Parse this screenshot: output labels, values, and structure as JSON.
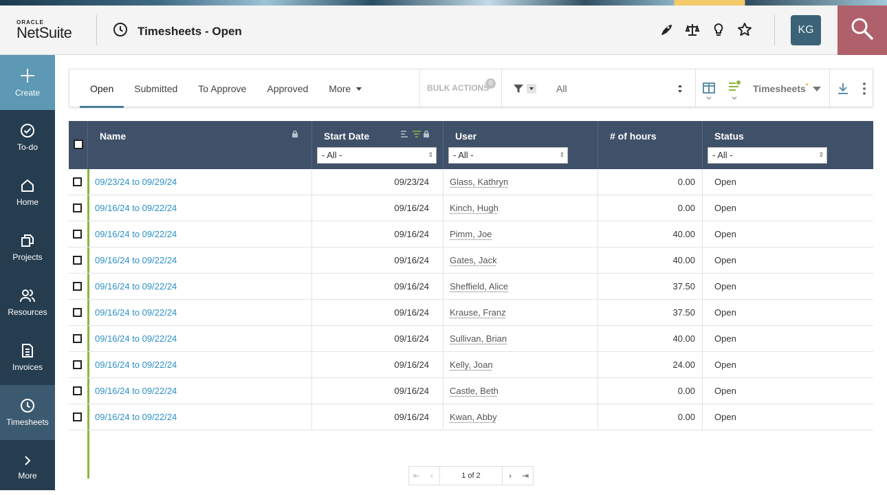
{
  "app": {
    "logo_small": "ORACLE",
    "logo_big": "NetSuite",
    "page_title": "Timesheets - Open",
    "user_initials": "KG"
  },
  "sidebar": {
    "items": [
      {
        "label": "Create",
        "icon": "plus-icon"
      },
      {
        "label": "To-do",
        "icon": "check-circle-icon"
      },
      {
        "label": "Home",
        "icon": "home-icon"
      },
      {
        "label": "Projects",
        "icon": "projects-icon"
      },
      {
        "label": "Resources",
        "icon": "people-icon"
      },
      {
        "label": "Invoices",
        "icon": "invoice-icon"
      },
      {
        "label": "Timesheets",
        "icon": "clock-icon"
      },
      {
        "label": "More",
        "icon": "chevron-right-icon"
      }
    ]
  },
  "toolbar": {
    "tabs": [
      "Open",
      "Submitted",
      "To Approve",
      "Approved",
      "More"
    ],
    "bulk_actions": "BULK ACTIONS",
    "bulk_count": "0",
    "filter_value": "All",
    "saved_search": "Timesheets",
    "saved_search_mark": "*"
  },
  "table": {
    "columns": {
      "name": "Name",
      "start_date": "Start Date",
      "user": "User",
      "hours": "# of hours",
      "status": "Status"
    },
    "filters": {
      "name": "- All -",
      "user": "- All -",
      "status": "- All -"
    },
    "rows": [
      {
        "name": "09/23/24 to 09/29/24",
        "start": "09/23/24",
        "user": "Glass, Kathryn",
        "hours": "0.00",
        "status": "Open"
      },
      {
        "name": "09/16/24 to 09/22/24",
        "start": "09/16/24",
        "user": "Kinch, Hugh",
        "hours": "0.00",
        "status": "Open"
      },
      {
        "name": "09/16/24 to 09/22/24",
        "start": "09/16/24",
        "user": "Pimm, Joe",
        "hours": "40.00",
        "status": "Open"
      },
      {
        "name": "09/16/24 to 09/22/24",
        "start": "09/16/24",
        "user": "Gates, Jack",
        "hours": "40.00",
        "status": "Open"
      },
      {
        "name": "09/16/24 to 09/22/24",
        "start": "09/16/24",
        "user": "Sheffield, Alice",
        "hours": "37.50",
        "status": "Open"
      },
      {
        "name": "09/16/24 to 09/22/24",
        "start": "09/16/24",
        "user": "Krause, Franz",
        "hours": "37.50",
        "status": "Open"
      },
      {
        "name": "09/16/24 to 09/22/24",
        "start": "09/16/24",
        "user": "Sullivan, Brian",
        "hours": "40.00",
        "status": "Open"
      },
      {
        "name": "09/16/24 to 09/22/24",
        "start": "09/16/24",
        "user": "Kelly, Joan",
        "hours": "24.00",
        "status": "Open"
      },
      {
        "name": "09/16/24 to 09/22/24",
        "start": "09/16/24",
        "user": "Castle, Beth",
        "hours": "0.00",
        "status": "Open"
      },
      {
        "name": "09/16/24 to 09/22/24",
        "start": "09/16/24",
        "user": "Kwan, Abby",
        "hours": "0.00",
        "status": "Open"
      }
    ]
  },
  "pager": {
    "page_text": "1 of 2"
  }
}
